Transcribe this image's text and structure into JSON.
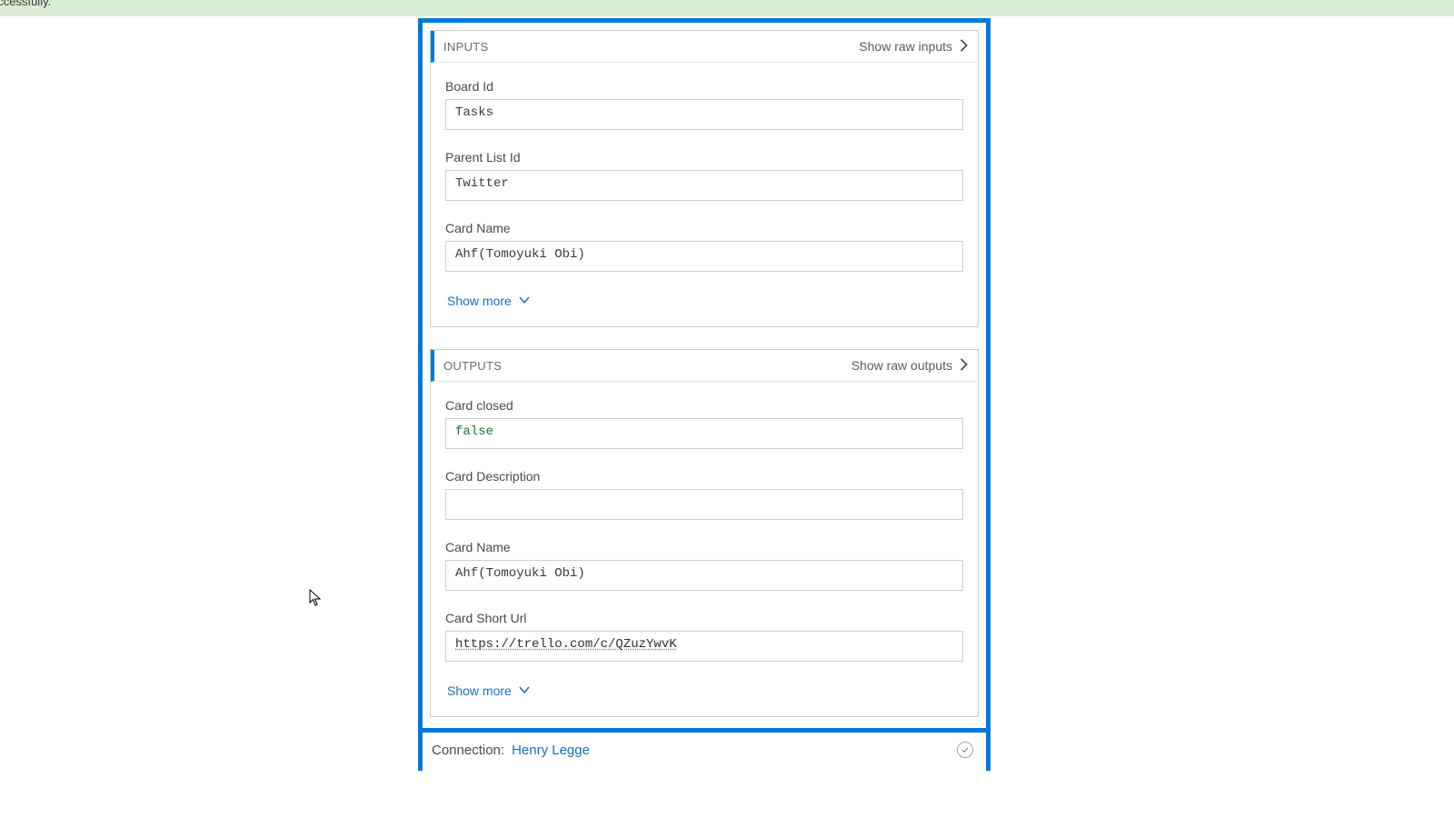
{
  "banner": {
    "text": "uccessfully."
  },
  "inputs": {
    "title": "INPUTS",
    "raw_link": "Show raw inputs",
    "fields": {
      "board_id": {
        "label": "Board Id",
        "value": "Tasks"
      },
      "parent_list": {
        "label": "Parent List Id",
        "value": "Twitter"
      },
      "card_name": {
        "label": "Card Name",
        "value": "Ahf(Tomoyuki Obi)"
      }
    },
    "show_more": "Show more"
  },
  "outputs": {
    "title": "OUTPUTS",
    "raw_link": "Show raw outputs",
    "fields": {
      "card_closed": {
        "label": "Card closed",
        "value": "false"
      },
      "card_desc": {
        "label": "Card Description",
        "value": ""
      },
      "card_name": {
        "label": "Card Name",
        "value": "Ahf(Tomoyuki Obi)"
      },
      "card_url": {
        "label": "Card Short Url",
        "value": "https://trello.com/c/QZuzYwvK"
      }
    },
    "show_more": "Show more"
  },
  "connection": {
    "label": "Connection:",
    "name": "Henry Legge"
  }
}
